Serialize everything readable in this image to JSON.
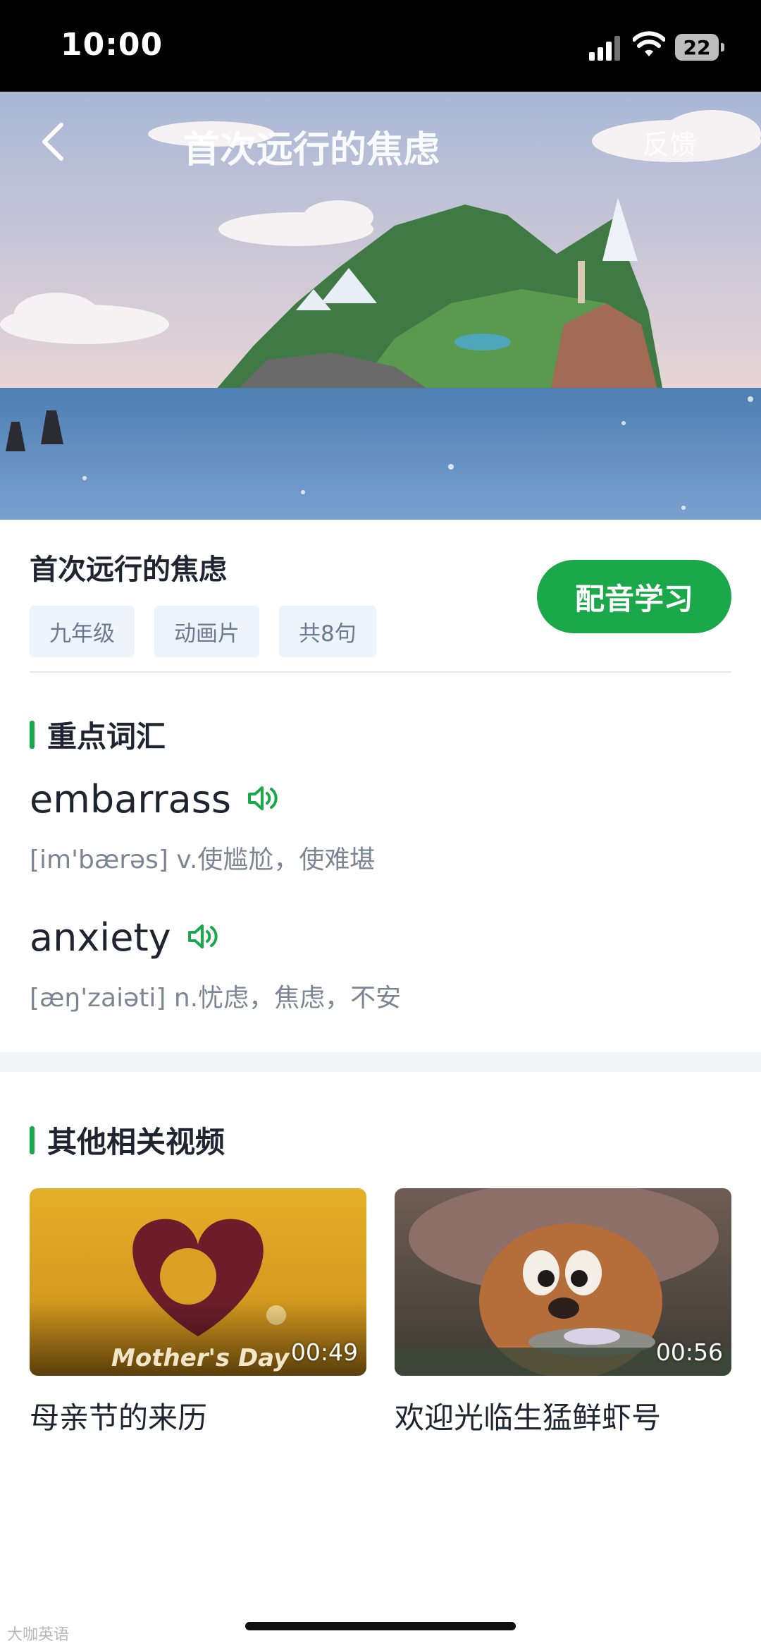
{
  "status": {
    "time": "10:00",
    "battery": "22"
  },
  "header": {
    "title": "首次远行的焦虑",
    "feedback": "反馈"
  },
  "video": {
    "title": "首次远行的焦虑",
    "tags": [
      "九年级",
      "动画片",
      "共8句"
    ],
    "dub_button": "配音学习"
  },
  "vocab": {
    "heading": "重点词汇",
    "items": [
      {
        "word": "embarrass",
        "def": "[im'bærəs] v.使尴尬，使难堪"
      },
      {
        "word": "anxiety",
        "def": "[æŋ'zaiəti] n.忧虑，焦虑，不安"
      }
    ]
  },
  "related": {
    "heading": "其他相关视频",
    "items": [
      {
        "title": "母亲节的来历",
        "duration": "00:49",
        "overlay": "Mother's Day"
      },
      {
        "title": "欢迎光临生猛鲜虾号",
        "duration": "00:56"
      }
    ]
  },
  "watermark": "大咖英语",
  "colors": {
    "accent": "#1aa84b",
    "tag_bg": "#eef4fb",
    "status_bar": "#000000"
  },
  "icons": [
    "chevron-left-icon",
    "speaker-icon",
    "signal-icon",
    "wifi-icon",
    "battery-icon"
  ]
}
